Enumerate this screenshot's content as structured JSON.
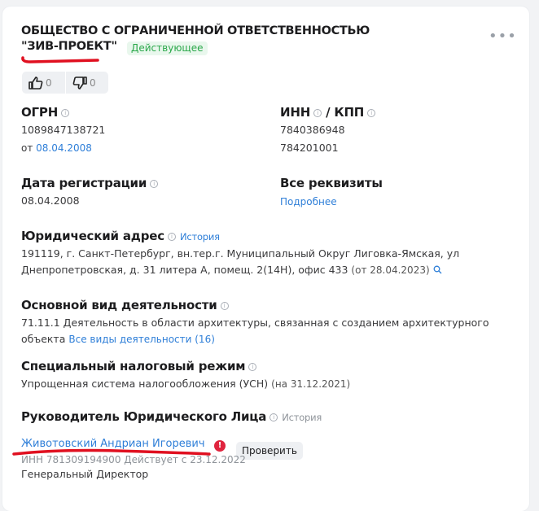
{
  "company": {
    "title_line1": "ОБЩЕСТВО С ОГРАНИЧЕННОЙ ОТВЕТСТВЕННОСТЬЮ",
    "title_line2": "\"ЗИВ-ПРОЕКТ\"",
    "status": "Действующее"
  },
  "votes": {
    "likes": "0",
    "dislikes": "0"
  },
  "ogrn": {
    "label": "ОГРН",
    "value": "1089847138721",
    "date_prefix": "от ",
    "date": "08.04.2008"
  },
  "inn": {
    "label_inn": "ИНН",
    "label_kpp": "/ КПП",
    "inn_value": "7840386948",
    "kpp_value": "784201001"
  },
  "registration": {
    "label": "Дата регистрации",
    "value": "08.04.2008"
  },
  "requisites": {
    "label": "Все реквизиты",
    "link": "Подробнее"
  },
  "address": {
    "label": "Юридический адрес",
    "history": "История",
    "line1": "191119, г. Санкт-Петербург, вн.тер.г. Муниципальный Округ Лиговка-Ямская, ул",
    "line2": "Днепропетровская, д. 31 литера А, помещ. 2(14Н), офис 433",
    "since": "(от 28.04.2023)"
  },
  "activity": {
    "label": "Основной вид деятельности",
    "line1": "71.11.1 Деятельность в области архитектуры, связанная с созданием архитектурного",
    "line2": "объекта",
    "all_link": "Все виды деятельности (16)"
  },
  "tax": {
    "label": "Специальный налоговый режим",
    "value": "Упрощенная система налогообложения (УСН)",
    "date": "(на 31.12.2021)"
  },
  "head": {
    "label": "Руководитель Юридического Лица",
    "history": "История",
    "name": "Животовский Андриан Игоревич",
    "check": "Проверить",
    "inn_line": "ИНН 781309194900   Действует с 23.12.2022",
    "position": "Генеральный Директор"
  },
  "colors": {
    "accent": "#2f7fd8",
    "status_green": "#2aa84a",
    "warning": "#e0243e",
    "underline": "#e01020"
  }
}
